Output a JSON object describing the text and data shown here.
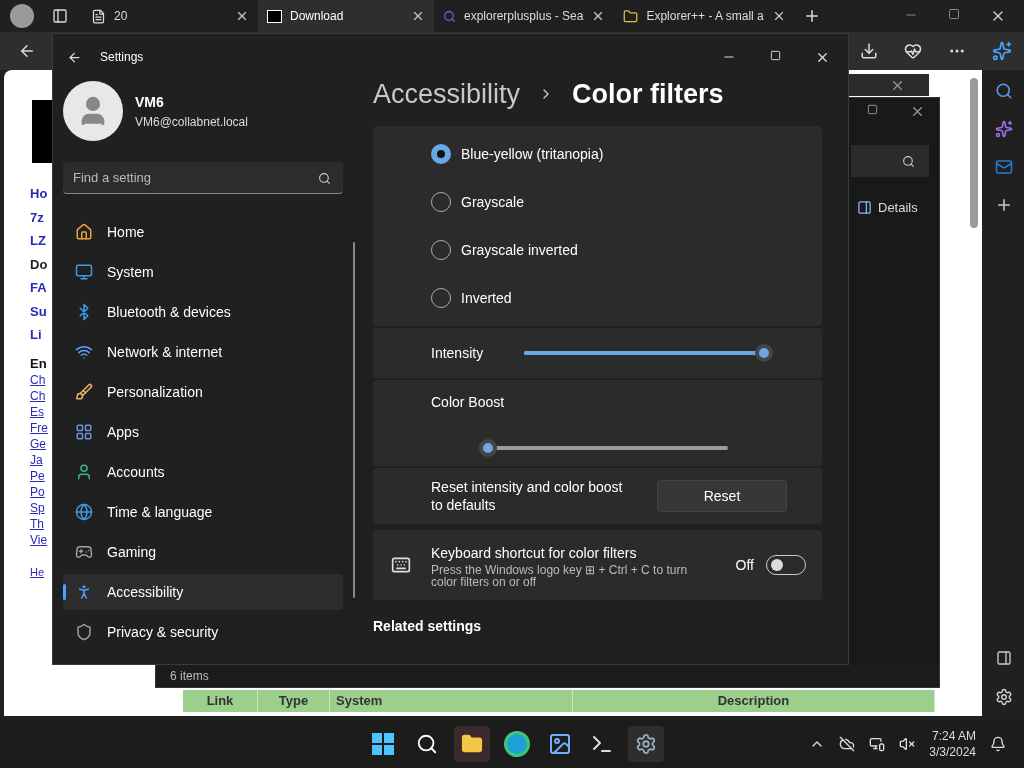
{
  "browser": {
    "tabs": [
      {
        "title": "20",
        "selected": false
      },
      {
        "title": "Download",
        "selected": true
      },
      {
        "title": "explorerplusplus - Sea",
        "selected": false
      },
      {
        "title": "Explorer++ - A small a",
        "selected": false
      }
    ]
  },
  "webpage": {
    "nav_links": [
      {
        "text": "Ho",
        "current": false
      },
      {
        "text": "7z",
        "current": false
      },
      {
        "text": "LZ",
        "current": false
      },
      {
        "text": "Do",
        "current": true
      },
      {
        "text": "FA",
        "current": false
      },
      {
        "text": "Su",
        "current": false
      },
      {
        "text": "Li",
        "current": false
      }
    ],
    "lang_heading": "En",
    "lang_links": [
      "Ch",
      "Ch",
      "Es",
      "Fre",
      "Ge",
      "Ja",
      "Pe",
      "Po",
      "Sp",
      "Th",
      "Vie"
    ],
    "footer_link": "He",
    "table_columns": [
      "Link",
      "Type",
      "System",
      "Description"
    ]
  },
  "explorer": {
    "details": "Details",
    "status": "6 items"
  },
  "settings": {
    "title": "Settings",
    "user": {
      "name": "VM6",
      "email": "VM6@collabnet.local"
    },
    "search": {
      "placeholder": "Find a setting"
    },
    "nav": [
      {
        "label": "Home",
        "selected": false
      },
      {
        "label": "System",
        "selected": false
      },
      {
        "label": "Bluetooth & devices",
        "selected": false
      },
      {
        "label": "Network & internet",
        "selected": false
      },
      {
        "label": "Personalization",
        "selected": false
      },
      {
        "label": "Apps",
        "selected": false
      },
      {
        "label": "Accounts",
        "selected": false
      },
      {
        "label": "Time & language",
        "selected": false
      },
      {
        "label": "Gaming",
        "selected": false
      },
      {
        "label": "Accessibility",
        "selected": true
      },
      {
        "label": "Privacy & security",
        "selected": false
      }
    ],
    "breadcrumb": [
      "Accessibility",
      "Color filters"
    ],
    "filters": [
      {
        "label": "Blue-yellow (tritanopia)",
        "selected": true
      },
      {
        "label": "Grayscale",
        "selected": false
      },
      {
        "label": "Grayscale inverted",
        "selected": false
      },
      {
        "label": "Inverted",
        "selected": false
      }
    ],
    "intensity": {
      "label": "Intensity",
      "level": 1
    },
    "color_boost": {
      "label": "Color Boost",
      "level": 0
    },
    "reset": {
      "label": "Reset intensity and color boost to defaults",
      "button": "Reset"
    },
    "shortcut": {
      "title": "Keyboard shortcut for color filters",
      "description": "Press the Windows logo key ⊞ + Ctrl + C to turn color filters on or off",
      "state_label": "Off",
      "on": false
    },
    "related": "Related settings"
  },
  "taskbar": {
    "time": "7:24 AM",
    "date": "3/3/2024"
  }
}
